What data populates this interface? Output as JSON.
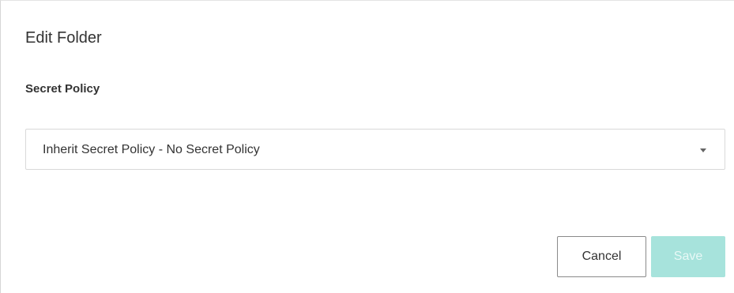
{
  "dialog": {
    "title": "Edit Folder",
    "secret_policy_label": "Secret Policy",
    "secret_policy_select": {
      "selected": "Inherit Secret Policy - No Secret Policy"
    },
    "buttons": {
      "cancel": "Cancel",
      "save": "Save"
    }
  },
  "colors": {
    "save_disabled_bg": "#a7e3dc",
    "text": "#333333",
    "border": "#d9d9d9"
  },
  "icons": {
    "select_caret": "caret-down-icon"
  }
}
